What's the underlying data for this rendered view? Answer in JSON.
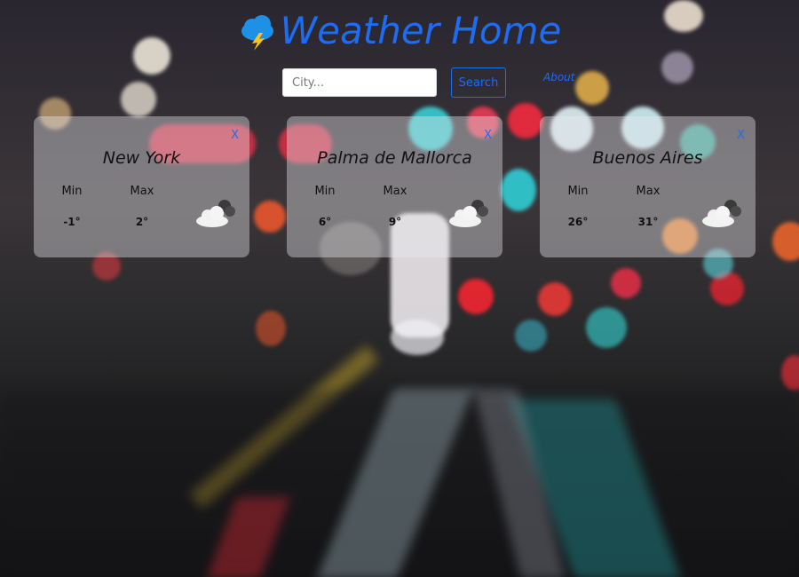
{
  "app": {
    "title": "Weather Home",
    "brand_icon": "cloud-lightning-icon",
    "accent_color": "#1e6cf0"
  },
  "search": {
    "placeholder": "City...",
    "value": "",
    "button_label": "Search"
  },
  "nav": {
    "about_label": "About"
  },
  "cards": [
    {
      "city": "New York",
      "close_label": "X",
      "min_label": "Min",
      "max_label": "Max",
      "min": "-1°",
      "max": "2°",
      "icon": "partly-cloudy-night-icon"
    },
    {
      "city": "Palma de Mallorca",
      "close_label": "X",
      "min_label": "Min",
      "max_label": "Max",
      "min": "6°",
      "max": "9°",
      "icon": "partly-cloudy-night-icon"
    },
    {
      "city": "Buenos Aires",
      "close_label": "X",
      "min_label": "Min",
      "max_label": "Max",
      "min": "26°",
      "max": "31°",
      "icon": "partly-cloudy-night-icon"
    }
  ]
}
